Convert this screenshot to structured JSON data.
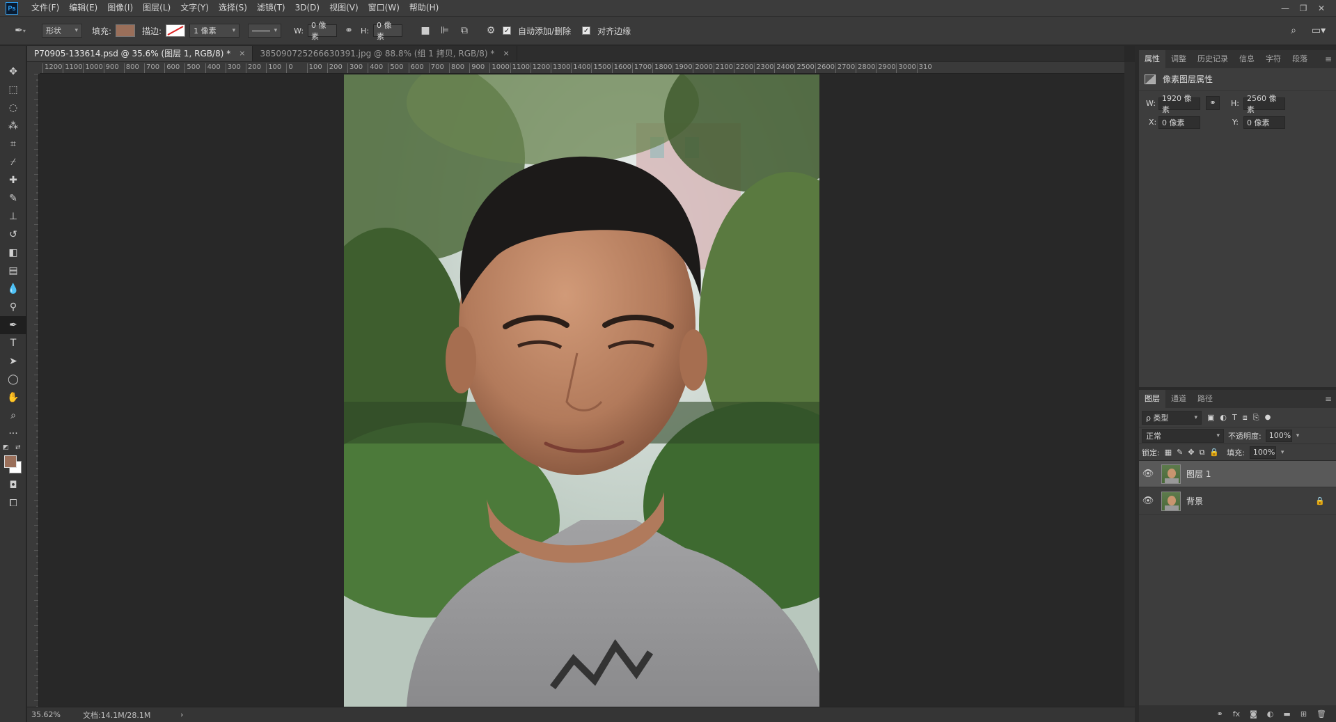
{
  "menubar": {
    "logo": "Ps",
    "items": [
      "文件(F)",
      "编辑(E)",
      "图像(I)",
      "图层(L)",
      "文字(Y)",
      "选择(S)",
      "滤镜(T)",
      "3D(D)",
      "视图(V)",
      "窗口(W)",
      "帮助(H)"
    ],
    "window_buttons": [
      "—",
      "❐",
      "✕"
    ]
  },
  "options": {
    "tool_mode": "形状",
    "fill_label": "填充:",
    "fill_color": "#9a6f5a",
    "stroke_label": "描边:",
    "stroke_width": "1 像素",
    "w_label": "W:",
    "w_value": "0 像素",
    "h_label": "H:",
    "h_value": "0 像素",
    "auto_add_delete": "自动添加/删除",
    "align_edges": "对齐边缘"
  },
  "tabs": [
    {
      "label": "P70905-133614.psd @ 35.6% (图层 1, RGB/8) *",
      "close": "×"
    },
    {
      "label": "385090725266630391.jpg @ 88.8% (组 1 拷贝, RGB/8) *",
      "close": "×"
    }
  ],
  "ruler_top": [
    "1200",
    "1100",
    "1000",
    "900",
    "800",
    "700",
    "600",
    "500",
    "400",
    "300",
    "200",
    "100",
    "0",
    "100",
    "200",
    "300",
    "400",
    "500",
    "600",
    "700",
    "800",
    "900",
    "1000",
    "1100",
    "1200",
    "1300",
    "1400",
    "1500",
    "1600",
    "1700",
    "1800",
    "1900",
    "2000",
    "2100",
    "2200",
    "2300",
    "2400",
    "2500",
    "2600",
    "2700",
    "2800",
    "2900",
    "3000",
    "310"
  ],
  "status": {
    "zoom": "35.62%",
    "doc": "文档:14.1M/28.1M",
    "arrow": "›"
  },
  "properties": {
    "tabs": [
      "属性",
      "调整",
      "历史记录",
      "信息",
      "字符",
      "段落"
    ],
    "menu": "≡",
    "title": "像素图层属性",
    "w_label": "W:",
    "w_value": "1920 像素",
    "h_label": "H:",
    "h_value": "2560 像素",
    "x_label": "X:",
    "x_value": "0 像素",
    "y_label": "Y:",
    "y_value": "0 像素"
  },
  "layers": {
    "tabs": [
      "图层",
      "通道",
      "路径"
    ],
    "menu": "≡",
    "filter": "ρ 类型",
    "blend": "正常",
    "opacity_label": "不透明度:",
    "opacity_value": "100%",
    "lock_label": "锁定:",
    "fill_label": "填充:",
    "fill_value": "100%",
    "items": [
      {
        "name": "图层 1",
        "selected": true
      },
      {
        "name": "背景",
        "locked": true
      }
    ],
    "footer_icons": [
      "link-icon",
      "fx-icon",
      "mask-icon",
      "adjustment-icon",
      "folder-icon",
      "new-layer-icon",
      "trash-icon"
    ]
  }
}
